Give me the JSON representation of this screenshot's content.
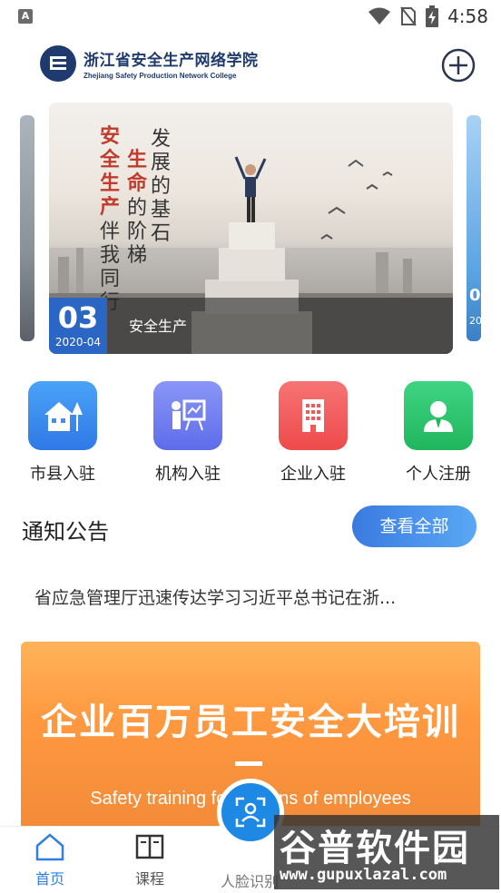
{
  "status_bar": {
    "time": "4:58",
    "left_icon_letter": "A"
  },
  "header": {
    "logo_cn": "浙江省安全生产网络学院",
    "logo_en": "Zhejiang Safety Production Network College"
  },
  "carousel": {
    "day": "03",
    "year_month": "2020-04",
    "caption": "安全生产",
    "banner_texts": [
      "安全生产",
      "伴我同行",
      "生命",
      "的阶梯",
      "发展的基石"
    ],
    "right_peek_day": "0",
    "right_peek_year": "20"
  },
  "entries": [
    {
      "label": "市县入驻",
      "icon": "house-tree-icon",
      "color": "#3d8ff2"
    },
    {
      "label": "机构入驻",
      "icon": "presentation-board-icon",
      "color": "#6e7ff2"
    },
    {
      "label": "企业入驻",
      "icon": "building-icon",
      "color": "#f25a5a"
    },
    {
      "label": "个人注册",
      "icon": "person-icon",
      "color": "#2ec46b"
    }
  ],
  "notice": {
    "title": "通知公告",
    "view_all": "查看全部",
    "item": "省应急管理厅迅速传达学习习近平总书记在浙..."
  },
  "promo": {
    "title": "企业百万员工安全大培训",
    "subtitle": "Safety training for millions of employees"
  },
  "bottom_nav": {
    "home": "首页",
    "course": "课程",
    "face": "人脸识别"
  },
  "watermark": {
    "cn": "谷普软件园",
    "en": "www.gupuxlazal.com"
  },
  "colors": {
    "primary": "#2b66c4",
    "accent_blue": "#1e88e5",
    "promo_orange": "#ff9940"
  }
}
